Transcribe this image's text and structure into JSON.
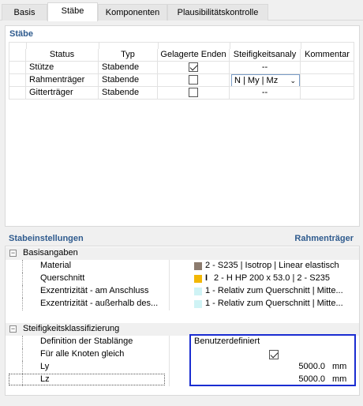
{
  "tabs": [
    "Basis",
    "Stäbe",
    "Komponenten",
    "Plausibilitätskontrolle"
  ],
  "staebe": {
    "title": "Stäbe",
    "columns": [
      "Status",
      "Typ",
      "Gelagerte Enden",
      "Steifigkeitsanaly",
      "Kommentar"
    ],
    "rows": [
      {
        "status": "Stütze",
        "typ": "Stabende",
        "gelagerte_enden": true,
        "steifigkeit": "--",
        "kommentar": ""
      },
      {
        "status": "Rahmenträger",
        "typ": "Stabende",
        "gelagerte_enden": false,
        "steifigkeit": "N | My | Mz",
        "kommentar": ""
      },
      {
        "status": "Gitterträger",
        "typ": "Stabende",
        "gelagerte_enden": false,
        "steifigkeit": "--",
        "kommentar": ""
      }
    ]
  },
  "stabeinstellungen": {
    "title": "Stabeinstellungen",
    "context": "Rahmenträger",
    "basisangaben": {
      "title": "Basisangaben",
      "toggle": "−",
      "items": [
        {
          "label": "Material",
          "value": "2 - S235 | Isotrop | Linear elastisch",
          "color": "#8c7b6e"
        },
        {
          "label": "Querschnitt",
          "value": "2 - H HP 200 x 53.0 | 2 - S235",
          "color": "#f2b705",
          "icon": "i-beam-icon"
        },
        {
          "label": "Exzentrizität - am Anschluss",
          "value": "1 - Relativ zum Querschnitt | Mitte...",
          "color": "#cff3f5"
        },
        {
          "label": "Exzentrizität - außerhalb des...",
          "value": "1 - Relativ zum Querschnitt | Mitte...",
          "color": "#cff3f5"
        }
      ]
    },
    "steifigkeit": {
      "title": "Steifigkeitsklassifizierung",
      "toggle": "−",
      "definition_label": "Definition der Stablänge",
      "definition_value": "Benutzerdefiniert",
      "alle_knoten_label": "Für alle Knoten gleich",
      "alle_knoten_checked": true,
      "ly_label": "Ly",
      "ly_value": "5000.0",
      "ly_unit": "mm",
      "lz_label": "Lz",
      "lz_value": "5000.0",
      "lz_unit": "mm"
    }
  },
  "colors": {
    "accent": "#2f5b8e",
    "highlight": "#1a2dd1"
  }
}
